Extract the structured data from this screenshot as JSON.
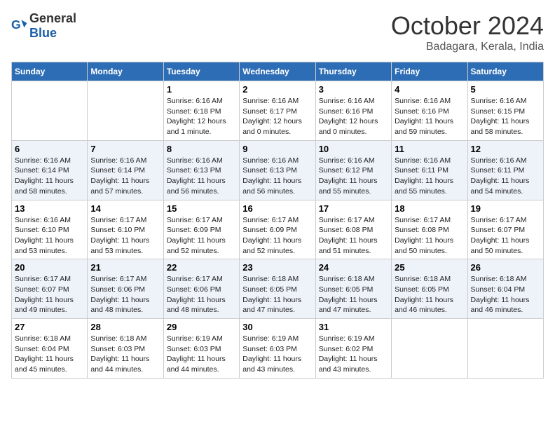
{
  "header": {
    "logo_general": "General",
    "logo_blue": "Blue",
    "month_title": "October 2024",
    "location": "Badagara, Kerala, India"
  },
  "weekdays": [
    "Sunday",
    "Monday",
    "Tuesday",
    "Wednesday",
    "Thursday",
    "Friday",
    "Saturday"
  ],
  "weeks": [
    [
      {
        "day": "",
        "sunrise": "",
        "sunset": "",
        "daylight": ""
      },
      {
        "day": "",
        "sunrise": "",
        "sunset": "",
        "daylight": ""
      },
      {
        "day": "1",
        "sunrise": "Sunrise: 6:16 AM",
        "sunset": "Sunset: 6:18 PM",
        "daylight": "Daylight: 12 hours and 1 minute."
      },
      {
        "day": "2",
        "sunrise": "Sunrise: 6:16 AM",
        "sunset": "Sunset: 6:17 PM",
        "daylight": "Daylight: 12 hours and 0 minutes."
      },
      {
        "day": "3",
        "sunrise": "Sunrise: 6:16 AM",
        "sunset": "Sunset: 6:16 PM",
        "daylight": "Daylight: 12 hours and 0 minutes."
      },
      {
        "day": "4",
        "sunrise": "Sunrise: 6:16 AM",
        "sunset": "Sunset: 6:16 PM",
        "daylight": "Daylight: 11 hours and 59 minutes."
      },
      {
        "day": "5",
        "sunrise": "Sunrise: 6:16 AM",
        "sunset": "Sunset: 6:15 PM",
        "daylight": "Daylight: 11 hours and 58 minutes."
      }
    ],
    [
      {
        "day": "6",
        "sunrise": "Sunrise: 6:16 AM",
        "sunset": "Sunset: 6:14 PM",
        "daylight": "Daylight: 11 hours and 58 minutes."
      },
      {
        "day": "7",
        "sunrise": "Sunrise: 6:16 AM",
        "sunset": "Sunset: 6:14 PM",
        "daylight": "Daylight: 11 hours and 57 minutes."
      },
      {
        "day": "8",
        "sunrise": "Sunrise: 6:16 AM",
        "sunset": "Sunset: 6:13 PM",
        "daylight": "Daylight: 11 hours and 56 minutes."
      },
      {
        "day": "9",
        "sunrise": "Sunrise: 6:16 AM",
        "sunset": "Sunset: 6:13 PM",
        "daylight": "Daylight: 11 hours and 56 minutes."
      },
      {
        "day": "10",
        "sunrise": "Sunrise: 6:16 AM",
        "sunset": "Sunset: 6:12 PM",
        "daylight": "Daylight: 11 hours and 55 minutes."
      },
      {
        "day": "11",
        "sunrise": "Sunrise: 6:16 AM",
        "sunset": "Sunset: 6:11 PM",
        "daylight": "Daylight: 11 hours and 55 minutes."
      },
      {
        "day": "12",
        "sunrise": "Sunrise: 6:16 AM",
        "sunset": "Sunset: 6:11 PM",
        "daylight": "Daylight: 11 hours and 54 minutes."
      }
    ],
    [
      {
        "day": "13",
        "sunrise": "Sunrise: 6:16 AM",
        "sunset": "Sunset: 6:10 PM",
        "daylight": "Daylight: 11 hours and 53 minutes."
      },
      {
        "day": "14",
        "sunrise": "Sunrise: 6:17 AM",
        "sunset": "Sunset: 6:10 PM",
        "daylight": "Daylight: 11 hours and 53 minutes."
      },
      {
        "day": "15",
        "sunrise": "Sunrise: 6:17 AM",
        "sunset": "Sunset: 6:09 PM",
        "daylight": "Daylight: 11 hours and 52 minutes."
      },
      {
        "day": "16",
        "sunrise": "Sunrise: 6:17 AM",
        "sunset": "Sunset: 6:09 PM",
        "daylight": "Daylight: 11 hours and 52 minutes."
      },
      {
        "day": "17",
        "sunrise": "Sunrise: 6:17 AM",
        "sunset": "Sunset: 6:08 PM",
        "daylight": "Daylight: 11 hours and 51 minutes."
      },
      {
        "day": "18",
        "sunrise": "Sunrise: 6:17 AM",
        "sunset": "Sunset: 6:08 PM",
        "daylight": "Daylight: 11 hours and 50 minutes."
      },
      {
        "day": "19",
        "sunrise": "Sunrise: 6:17 AM",
        "sunset": "Sunset: 6:07 PM",
        "daylight": "Daylight: 11 hours and 50 minutes."
      }
    ],
    [
      {
        "day": "20",
        "sunrise": "Sunrise: 6:17 AM",
        "sunset": "Sunset: 6:07 PM",
        "daylight": "Daylight: 11 hours and 49 minutes."
      },
      {
        "day": "21",
        "sunrise": "Sunrise: 6:17 AM",
        "sunset": "Sunset: 6:06 PM",
        "daylight": "Daylight: 11 hours and 48 minutes."
      },
      {
        "day": "22",
        "sunrise": "Sunrise: 6:17 AM",
        "sunset": "Sunset: 6:06 PM",
        "daylight": "Daylight: 11 hours and 48 minutes."
      },
      {
        "day": "23",
        "sunrise": "Sunrise: 6:18 AM",
        "sunset": "Sunset: 6:05 PM",
        "daylight": "Daylight: 11 hours and 47 minutes."
      },
      {
        "day": "24",
        "sunrise": "Sunrise: 6:18 AM",
        "sunset": "Sunset: 6:05 PM",
        "daylight": "Daylight: 11 hours and 47 minutes."
      },
      {
        "day": "25",
        "sunrise": "Sunrise: 6:18 AM",
        "sunset": "Sunset: 6:05 PM",
        "daylight": "Daylight: 11 hours and 46 minutes."
      },
      {
        "day": "26",
        "sunrise": "Sunrise: 6:18 AM",
        "sunset": "Sunset: 6:04 PM",
        "daylight": "Daylight: 11 hours and 46 minutes."
      }
    ],
    [
      {
        "day": "27",
        "sunrise": "Sunrise: 6:18 AM",
        "sunset": "Sunset: 6:04 PM",
        "daylight": "Daylight: 11 hours and 45 minutes."
      },
      {
        "day": "28",
        "sunrise": "Sunrise: 6:18 AM",
        "sunset": "Sunset: 6:03 PM",
        "daylight": "Daylight: 11 hours and 44 minutes."
      },
      {
        "day": "29",
        "sunrise": "Sunrise: 6:19 AM",
        "sunset": "Sunset: 6:03 PM",
        "daylight": "Daylight: 11 hours and 44 minutes."
      },
      {
        "day": "30",
        "sunrise": "Sunrise: 6:19 AM",
        "sunset": "Sunset: 6:03 PM",
        "daylight": "Daylight: 11 hours and 43 minutes."
      },
      {
        "day": "31",
        "sunrise": "Sunrise: 6:19 AM",
        "sunset": "Sunset: 6:02 PM",
        "daylight": "Daylight: 11 hours and 43 minutes."
      },
      {
        "day": "",
        "sunrise": "",
        "sunset": "",
        "daylight": ""
      },
      {
        "day": "",
        "sunrise": "",
        "sunset": "",
        "daylight": ""
      }
    ]
  ]
}
